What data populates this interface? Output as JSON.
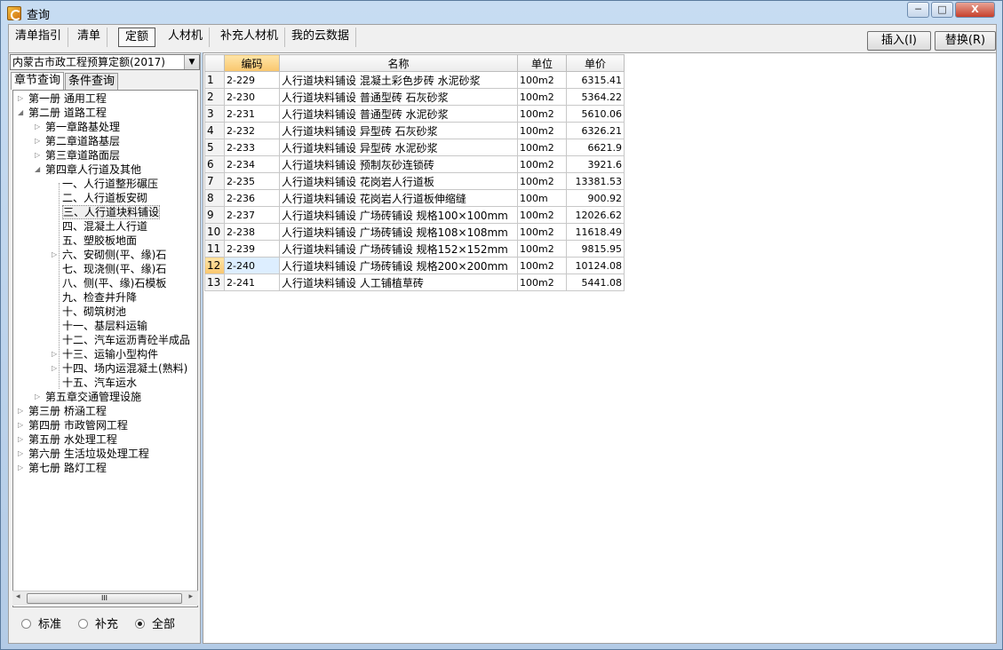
{
  "window": {
    "title": "查询",
    "min": "─",
    "max": "□",
    "close": "X"
  },
  "tabs": [
    {
      "label": "清单指引"
    },
    {
      "label": "清单"
    },
    {
      "label": "定额"
    },
    {
      "label": "人材机"
    },
    {
      "label": "补充人材机"
    },
    {
      "label": "我的云数据"
    }
  ],
  "buttons": {
    "insert": "插入(I)",
    "replace": "替换(R)"
  },
  "quota_select": "内蒙古市政工程预算定额(2017)",
  "left_tabs": {
    "chapter": "章节查询",
    "condition": "条件查询"
  },
  "tree": [
    {
      "label": "第一册 通用工程",
      "exp": "▷"
    },
    {
      "label": "第二册 道路工程",
      "exp": "◢"
    },
    {
      "label": "第一章路基处理",
      "exp": "▷"
    },
    {
      "label": "第二章道路基层",
      "exp": "▷"
    },
    {
      "label": "第三章道路面层",
      "exp": "▷"
    },
    {
      "label": "第四章人行道及其他",
      "exp": "◢"
    },
    {
      "label": "一、人行道整形碾压",
      "exp": ""
    },
    {
      "label": "二、人行道板安砌",
      "exp": ""
    },
    {
      "label": "三、人行道块料铺设",
      "exp": ""
    },
    {
      "label": "四、混凝土人行道",
      "exp": ""
    },
    {
      "label": "五、塑胶板地面",
      "exp": ""
    },
    {
      "label": "六、安砌侧(平、缘)石",
      "exp": "▷"
    },
    {
      "label": "七、现浇侧(平、缘)石",
      "exp": ""
    },
    {
      "label": "八、侧(平、缘)石模板",
      "exp": ""
    },
    {
      "label": "九、检查井升降",
      "exp": ""
    },
    {
      "label": "十、砌筑树池",
      "exp": ""
    },
    {
      "label": "十一、基层料运输",
      "exp": ""
    },
    {
      "label": "十二、汽车运沥青砼半成品",
      "exp": ""
    },
    {
      "label": "十三、运输小型构件",
      "exp": "▷"
    },
    {
      "label": "十四、场内运混凝土(熟料)",
      "exp": "▷"
    },
    {
      "label": "十五、汽车运水",
      "exp": ""
    },
    {
      "label": "第五章交通管理设施",
      "exp": "▷"
    },
    {
      "label": "第三册 桥涵工程",
      "exp": "▷"
    },
    {
      "label": "第四册 市政管网工程",
      "exp": "▷"
    },
    {
      "label": "第五册 水处理工程",
      "exp": "▷"
    },
    {
      "label": "第六册 生活垃圾处理工程",
      "exp": "▷"
    },
    {
      "label": "第七册 路灯工程",
      "exp": "▷"
    }
  ],
  "scroll_grip": "III",
  "radios": {
    "standard": "标准",
    "supplement": "补充",
    "all": "全部"
  },
  "table": {
    "headers": {
      "code": "编码",
      "name": "名称",
      "unit": "单位",
      "price": "单价"
    },
    "rows": [
      {
        "n": "1",
        "code": "2-229",
        "name": "人行道块料铺设 混凝土彩色步砖 水泥砂浆",
        "unit": "100m2",
        "price": "6315.41"
      },
      {
        "n": "2",
        "code": "2-230",
        "name": "人行道块料铺设 普通型砖 石灰砂浆",
        "unit": "100m2",
        "price": "5364.22"
      },
      {
        "n": "3",
        "code": "2-231",
        "name": "人行道块料铺设 普通型砖 水泥砂浆",
        "unit": "100m2",
        "price": "5610.06"
      },
      {
        "n": "4",
        "code": "2-232",
        "name": "人行道块料铺设 异型砖 石灰砂浆",
        "unit": "100m2",
        "price": "6326.21"
      },
      {
        "n": "5",
        "code": "2-233",
        "name": "人行道块料铺设 异型砖 水泥砂浆",
        "unit": "100m2",
        "price": "6621.9"
      },
      {
        "n": "6",
        "code": "2-234",
        "name": "人行道块料铺设 预制灰砂连锁砖",
        "unit": "100m2",
        "price": "3921.6"
      },
      {
        "n": "7",
        "code": "2-235",
        "name": "人行道块料铺设 花岗岩人行道板",
        "unit": "100m2",
        "price": "13381.53"
      },
      {
        "n": "8",
        "code": "2-236",
        "name": "人行道块料铺设 花岗岩人行道板伸缩缝",
        "unit": "100m",
        "price": "900.92"
      },
      {
        "n": "9",
        "code": "2-237",
        "name": "人行道块料铺设 广场砖铺设 规格100×100mm",
        "unit": "100m2",
        "price": "12026.62"
      },
      {
        "n": "10",
        "code": "2-238",
        "name": "人行道块料铺设 广场砖铺设 规格108×108mm",
        "unit": "100m2",
        "price": "11618.49"
      },
      {
        "n": "11",
        "code": "2-239",
        "name": "人行道块料铺设 广场砖铺设 规格152×152mm",
        "unit": "100m2",
        "price": "9815.95"
      },
      {
        "n": "12",
        "code": "2-240",
        "name": "人行道块料铺设 广场砖铺设 规格200×200mm",
        "unit": "100m2",
        "price": "10124.08"
      },
      {
        "n": "13",
        "code": "2-241",
        "name": "人行道块料铺设 人工铺植草砖",
        "unit": "100m2",
        "price": "5441.08"
      }
    ]
  }
}
